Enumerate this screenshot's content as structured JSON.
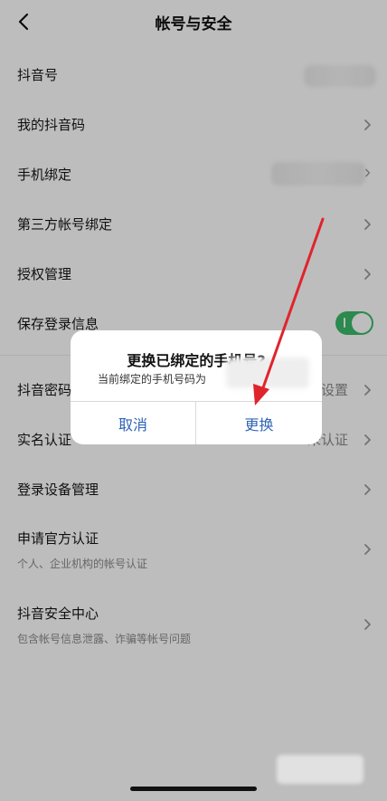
{
  "header": {
    "title": "帐号与安全"
  },
  "rows": [
    {
      "label": "抖音号"
    },
    {
      "label": "我的抖音码"
    },
    {
      "label": "手机绑定"
    },
    {
      "label": "第三方帐号绑定"
    },
    {
      "label": "授权管理"
    },
    {
      "label": "保存登录信息"
    },
    {
      "label": "抖音密码",
      "value": "已设置"
    },
    {
      "label": "实名认证",
      "value": "未认证"
    },
    {
      "label": "登录设备管理"
    },
    {
      "label": "申请官方认证",
      "sub": "个人、企业机构的帐号认证"
    },
    {
      "label": "抖音安全中心",
      "sub": "包含帐号信息泄露、诈骗等帐号问题"
    }
  ],
  "dialog": {
    "title": "更换已绑定的手机号?",
    "message": "当前绑定的手机号码为",
    "cancel": "取消",
    "confirm": "更换"
  },
  "colors": {
    "toggle_on": "#3bbb6a",
    "dialog_button": "#2f64b4",
    "annotation_arrow": "#e0242c"
  },
  "toggle": {
    "save_login_info": true
  }
}
